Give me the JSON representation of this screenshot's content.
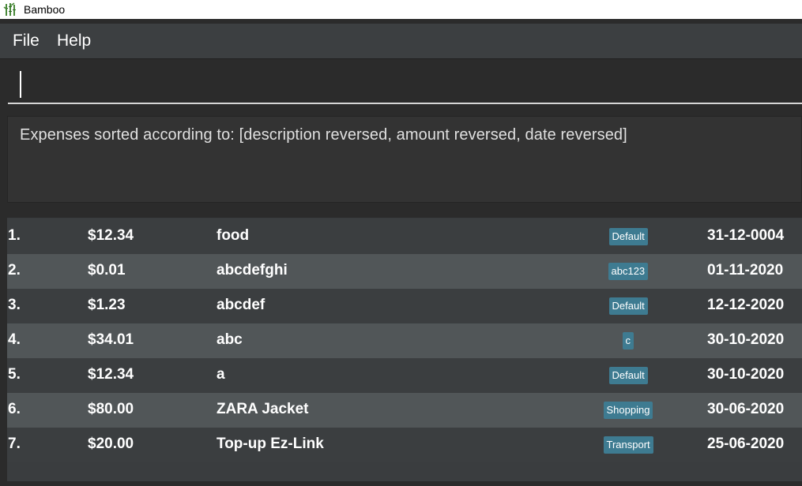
{
  "window": {
    "title": "Bamboo",
    "icon": "bamboo-icon"
  },
  "menu": {
    "file": "File",
    "help": "Help"
  },
  "command": {
    "value": ""
  },
  "result": {
    "text": "Expenses sorted according to: [description reversed, amount reversed, date reversed]"
  },
  "colors": {
    "tag_bg": "#3e7b91",
    "row_odd": "#3b3e40",
    "row_even": "#515658"
  },
  "expenses": [
    {
      "index": "1.",
      "amount": "$12.34",
      "description": "food",
      "tag": "Default",
      "date": "31-12-0004"
    },
    {
      "index": "2.",
      "amount": "$0.01",
      "description": "abcdefghi",
      "tag": "abc123",
      "date": "01-11-2020"
    },
    {
      "index": "3.",
      "amount": "$1.23",
      "description": "abcdef",
      "tag": "Default",
      "date": "12-12-2020"
    },
    {
      "index": "4.",
      "amount": "$34.01",
      "description": "abc",
      "tag": "c",
      "date": "30-10-2020"
    },
    {
      "index": "5.",
      "amount": "$12.34",
      "description": "a",
      "tag": "Default",
      "date": "30-10-2020"
    },
    {
      "index": "6.",
      "amount": "$80.00",
      "description": "ZARA Jacket",
      "tag": "Shopping",
      "date": "30-06-2020"
    },
    {
      "index": "7.",
      "amount": "$20.00",
      "description": "Top-up Ez-Link",
      "tag": "Transport",
      "date": "25-06-2020"
    }
  ]
}
